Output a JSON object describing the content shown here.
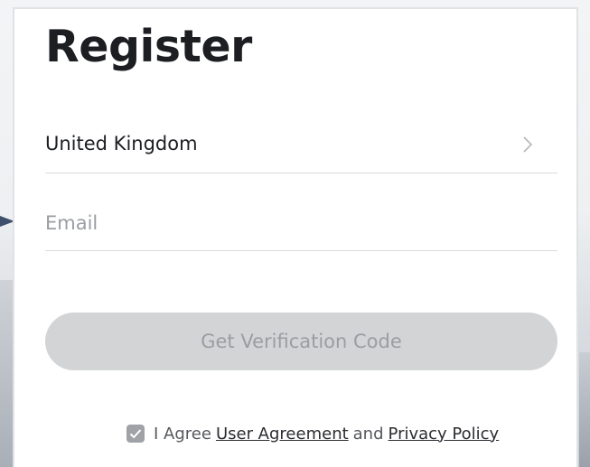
{
  "page": {
    "title": "Register"
  },
  "country": {
    "value": "United Kingdom",
    "icon": "chevron-right-icon"
  },
  "email": {
    "placeholder": "Email",
    "value": ""
  },
  "verify_button": {
    "label": "Get Verification Code",
    "enabled": false
  },
  "agreement": {
    "checked": true,
    "prefix": "I Agree",
    "user_agreement_link": "User Agreement",
    "connector": "and",
    "privacy_policy_link": "Privacy Policy"
  },
  "colors": {
    "title_text": "#1c1e22",
    "button_disabled_bg": "#d3d4d6",
    "button_disabled_text": "#9b9da1",
    "checkbox_bg": "#9fa3a8",
    "divider": "#d9dbdf"
  }
}
